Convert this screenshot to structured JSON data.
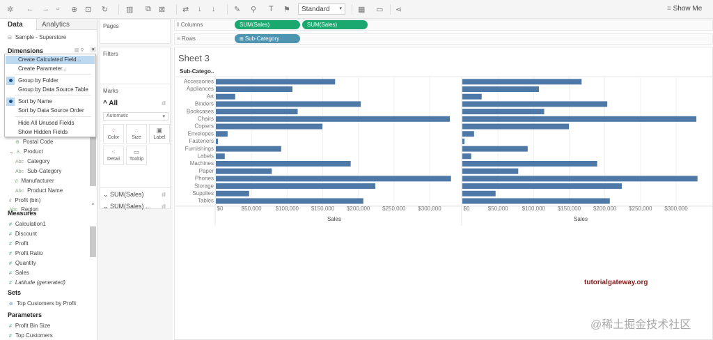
{
  "toolbar": {
    "style_select": "Standard",
    "show_me": "Show Me",
    "icons": [
      "tableau-logo-icon",
      "back-icon",
      "forward-icon",
      "save-icon",
      "new-datasource-icon",
      "pause-icon",
      "refresh-icon",
      "new-worksheet-icon",
      "duplicate-icon",
      "clear-icon",
      "swap-icon",
      "sort-asc-icon",
      "sort-desc-icon",
      "highlight-icon",
      "group-icon",
      "label-icon",
      "pin-icon",
      "chart-icon",
      "presentation-icon",
      "share-icon"
    ]
  },
  "left": {
    "tabs": [
      "Data",
      "Analytics"
    ],
    "datasource": "Sample - Superstore",
    "dimensions_title": "Dimensions",
    "dimensions": [
      {
        "name": "Postal Code",
        "icon": "globe-icon"
      },
      {
        "name": "Product",
        "icon": "hierarchy-icon"
      },
      {
        "name": "Category",
        "icon": "abc-icon"
      },
      {
        "name": "Sub-Category",
        "icon": "abc-icon"
      },
      {
        "name": "Manufacturer",
        "icon": "link-icon"
      },
      {
        "name": "Product Name",
        "icon": "abc-icon"
      },
      {
        "name": "Profit (bin)",
        "icon": "bin-icon"
      },
      {
        "name": "Region",
        "icon": "abc-icon"
      }
    ],
    "measures_title": "Measures",
    "measures": [
      "Calculation1",
      "Discount",
      "Profit",
      "Profit Ratio",
      "Quantity",
      "Sales",
      "Latitude (generated)"
    ],
    "sets_title": "Sets",
    "sets": [
      "Top Customers by Profit"
    ],
    "parameters_title": "Parameters",
    "parameters": [
      "Profit Bin Size",
      "Top Customers"
    ]
  },
  "menu": {
    "items": [
      "Create Calculated Field...",
      "Create Parameter...",
      "Group by Folder",
      "Group by Data Source Table",
      "Sort by Name",
      "Sort by Data Source Order",
      "Hide All Unused Fields",
      "Show Hidden Fields"
    ],
    "highlighted": "Create Calculated Field...",
    "checked": [
      "Group by Folder",
      "Sort by Name"
    ]
  },
  "mid": {
    "pages": "Pages",
    "filters": "Filters",
    "marks": "Marks",
    "all": "All",
    "mark_type": "Automatic",
    "buttons": [
      "Color",
      "Size",
      "Label",
      "Detail",
      "Tooltip"
    ],
    "mark_cards": [
      "SUM(Sales)",
      "SUM(Sales) ..."
    ]
  },
  "shelves": {
    "columns_label": "Columns",
    "rows_label": "Rows",
    "columns": [
      "SUM(Sales)",
      "SUM(Sales)"
    ],
    "rows": [
      "Sub-Category"
    ],
    "measure_color": "#1aa86f",
    "dimension_color": "#4d94b0"
  },
  "sheet_title": "Sheet 3",
  "watermark": "tutorialgateway.org",
  "watermark2": "@稀土掘金技术社区",
  "chart_data": {
    "type": "bar",
    "orientation": "horizontal",
    "row_header": "Sub-Catego..",
    "xlabel": "Sales",
    "xlim": [
      0,
      330007
    ],
    "bar_color": "#4e79a7",
    "ticks": [
      "$0",
      "$50,000",
      "$100,000",
      "$150,000",
      "$200,000",
      "$250,000",
      "$300,000"
    ],
    "tick_values": [
      0,
      50000,
      100000,
      150000,
      200000,
      250000,
      300000
    ],
    "categories": [
      "Accessories",
      "Appliances",
      "Art",
      "Binders",
      "Bookcases",
      "Chairs",
      "Copiers",
      "Envelopes",
      "Fasteners",
      "Furnishings",
      "Labels",
      "Machines",
      "Paper",
      "Phones",
      "Storage",
      "Supplies",
      "Tables"
    ],
    "series": [
      {
        "values": [
          167380,
          107532,
          27119,
          203413,
          114880,
          328449,
          149528,
          16476,
          3024,
          91705,
          12486,
          189239,
          78479,
          330007,
          223844,
          46674,
          206966
        ]
      },
      {
        "values": [
          167380,
          107532,
          27119,
          203413,
          114880,
          328449,
          149528,
          16476,
          3024,
          91705,
          12486,
          189239,
          78479,
          330007,
          223844,
          46674,
          206966
        ]
      }
    ]
  }
}
